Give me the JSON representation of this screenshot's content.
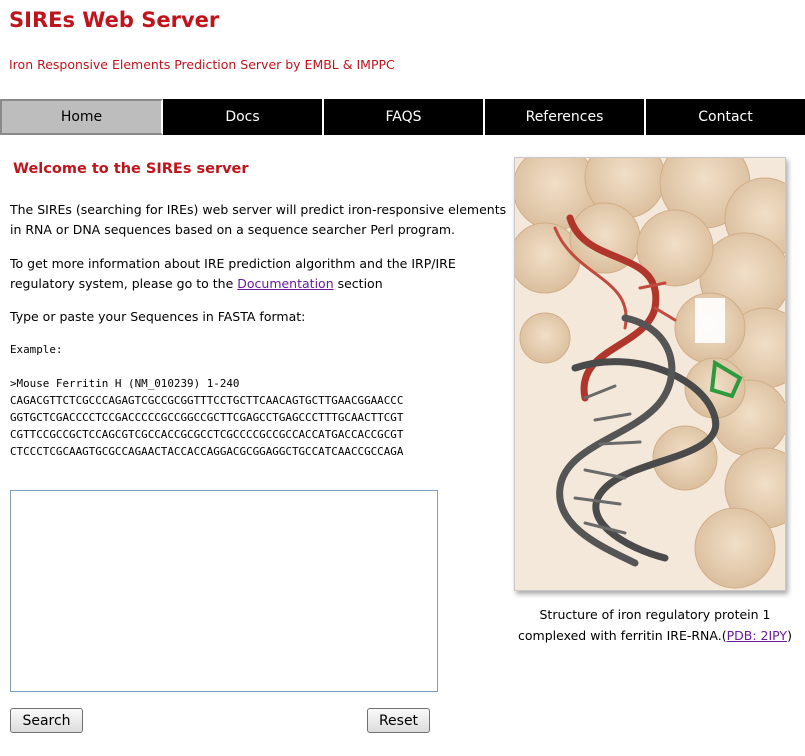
{
  "header": {
    "title": "SIREs Web Server",
    "subtitle": "Iron Responsive Elements Prediction Server by EMBL & IMPPC"
  },
  "nav": {
    "items": [
      {
        "label": "Home",
        "active": true
      },
      {
        "label": "Docs",
        "active": false
      },
      {
        "label": "FAQS",
        "active": false
      },
      {
        "label": "References",
        "active": false
      },
      {
        "label": "Contact",
        "active": false
      }
    ]
  },
  "main": {
    "welcome": "Welcome to the SIREs server",
    "intro": "The SIREs (searching for IREs) web server will predict iron-responsive elements in RNA or DNA sequences based on a sequence searcher Perl program.",
    "info_prefix": "To get more information about IRE prediction algorithm and the IRP/IRE regulatory system, please go to the ",
    "info_link": "Documentation",
    "info_suffix": " section",
    "instruction": "Type or paste your Sequences in FASTA format:",
    "example_label": "Example:",
    "example_header": ">Mouse Ferritin H (NM_010239) 1-240",
    "example_lines": [
      "CAGACGTTCTCGCCCAGAGTCGCCGCGGTTTCCTGCTTCAACAGTGCTTGAACGGAACCC",
      "GGTGCTCGACCCCTCCGACCCCCGCCGGCCGCTTCGAGCCTGAGCCCTTTGCAACTTCGT",
      "CGTTCCGCCGCTCCAGCGTCGCCACCGCGCCTCGCCCCGCCGCCACCATGACCACCGCGT",
      "CTCCCTCGCAAGTGCGCCAGAACTACCACCAGGACGCGGAGGCTGCCATCAACCGCCAGA"
    ],
    "textarea_value": "",
    "search_label": "Search",
    "reset_label": "Reset"
  },
  "figure": {
    "caption": "Structure of iron regulatory protein 1 complexed with ferritin IRE-RNA.",
    "caption_open": "(",
    "caption_link": "PDB: 2IPY",
    "caption_close": ")",
    "colors": {
      "protein_surface": "#e9d3b9",
      "rna_backbone": "#4a4a4a",
      "loop_red": "#b0352b",
      "green_base": "#2e9a3e"
    }
  }
}
